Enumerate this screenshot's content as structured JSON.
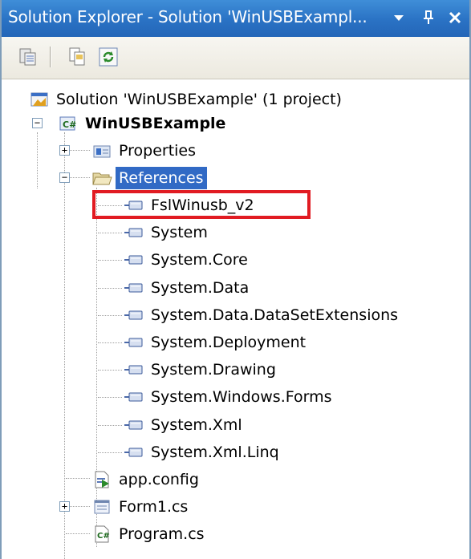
{
  "window": {
    "title": "Solution Explorer - Solution 'WinUSBExampl...",
    "dropdown_icon": "triangle-down",
    "pin_icon": "pin",
    "close_icon": "close-x"
  },
  "toolbar": {
    "buttons": [
      {
        "name": "properties-icon"
      },
      {
        "name": "show-all-files-icon"
      },
      {
        "name": "refresh-icon"
      }
    ]
  },
  "tree": {
    "solution": {
      "label": "Solution 'WinUSBExample' (1 project)"
    },
    "project": {
      "label": "WinUSBExample",
      "expander": "−"
    },
    "properties": {
      "label": "Properties",
      "expander": "+"
    },
    "references": {
      "label": "References",
      "expander": "−",
      "items": [
        "FslWinusb_v2",
        "System",
        "System.Core",
        "System.Data",
        "System.Data.DataSetExtensions",
        "System.Deployment",
        "System.Drawing",
        "System.Windows.Forms",
        "System.Xml",
        "System.Xml.Linq"
      ]
    },
    "app_config": {
      "label": "app.config"
    },
    "form1": {
      "label": "Form1.cs",
      "expander": "+"
    },
    "program": {
      "label": "Program.cs"
    }
  },
  "colors": {
    "title_bar": "#2a72c4",
    "selection": "#316ac5",
    "highlight_box": "#e11b22"
  }
}
